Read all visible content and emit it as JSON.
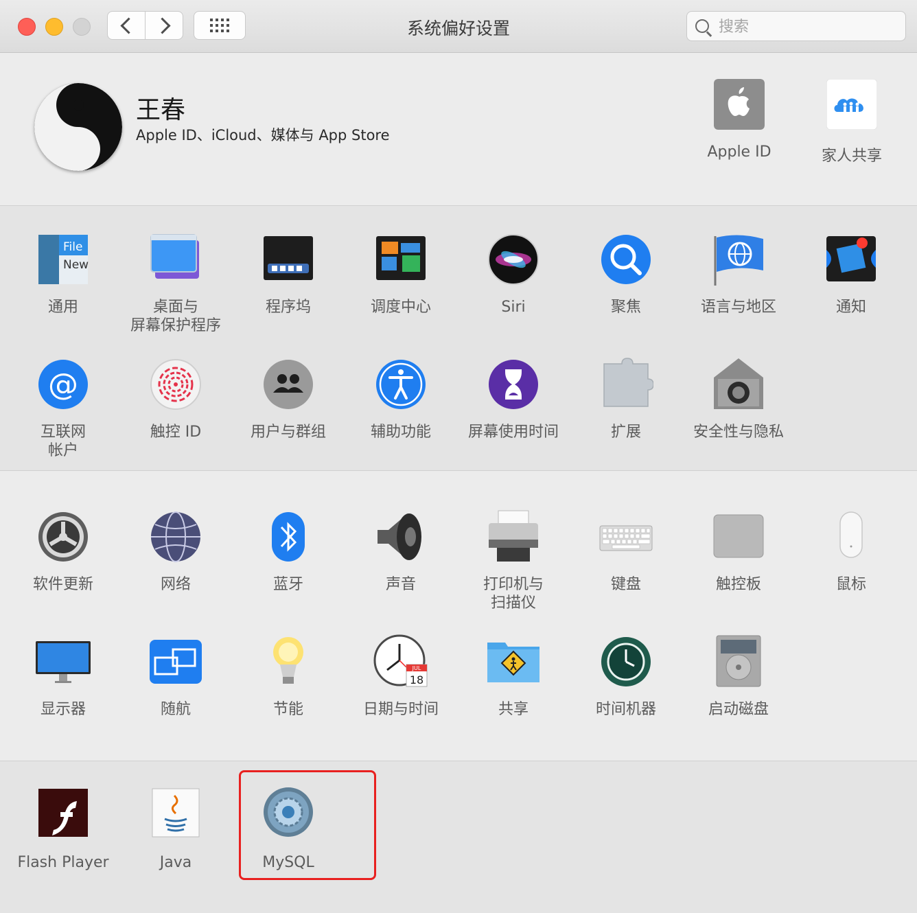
{
  "window": {
    "title": "系统偏好设置"
  },
  "search": {
    "placeholder": "搜索"
  },
  "account": {
    "name": "王春",
    "subtitle": "Apple ID、iCloud、媒体与 App Store",
    "items": [
      {
        "label": "Apple ID",
        "icon": "apple-icon"
      },
      {
        "label": "家人共享",
        "icon": "family-sharing-icon"
      }
    ]
  },
  "section1": {
    "row1": [
      {
        "label1": "通用",
        "label2": "",
        "icon": "general-icon"
      },
      {
        "label1": "桌面与",
        "label2": "屏幕保护程序",
        "icon": "desktop-icon"
      },
      {
        "label1": "程序坞",
        "label2": "",
        "icon": "dock-icon"
      },
      {
        "label1": "调度中心",
        "label2": "",
        "icon": "mission-control-icon"
      },
      {
        "label1": "Siri",
        "label2": "",
        "icon": "siri-icon"
      },
      {
        "label1": "聚焦",
        "label2": "",
        "icon": "spotlight-icon"
      },
      {
        "label1": "语言与地区",
        "label2": "",
        "icon": "language-icon"
      },
      {
        "label1": "通知",
        "label2": "",
        "icon": "notifications-icon"
      }
    ],
    "row2": [
      {
        "label1": "互联网",
        "label2": "帐户",
        "icon": "internet-accounts-icon"
      },
      {
        "label1": "触控 ID",
        "label2": "",
        "icon": "touch-id-icon"
      },
      {
        "label1": "用户与群组",
        "label2": "",
        "icon": "users-groups-icon"
      },
      {
        "label1": "辅助功能",
        "label2": "",
        "icon": "accessibility-icon"
      },
      {
        "label1": "屏幕使用时间",
        "label2": "",
        "icon": "screen-time-icon"
      },
      {
        "label1": "扩展",
        "label2": "",
        "icon": "extensions-icon"
      },
      {
        "label1": "安全性与隐私",
        "label2": "",
        "icon": "security-icon"
      }
    ]
  },
  "section2": {
    "row1": [
      {
        "label1": "软件更新",
        "label2": "",
        "icon": "software-update-icon"
      },
      {
        "label1": "网络",
        "label2": "",
        "icon": "network-icon"
      },
      {
        "label1": "蓝牙",
        "label2": "",
        "icon": "bluetooth-icon"
      },
      {
        "label1": "声音",
        "label2": "",
        "icon": "sound-icon"
      },
      {
        "label1": "打印机与",
        "label2": "扫描仪",
        "icon": "printer-icon"
      },
      {
        "label1": "键盘",
        "label2": "",
        "icon": "keyboard-icon"
      },
      {
        "label1": "触控板",
        "label2": "",
        "icon": "trackpad-icon"
      },
      {
        "label1": "鼠标",
        "label2": "",
        "icon": "mouse-icon"
      }
    ],
    "row2": [
      {
        "label1": "显示器",
        "label2": "",
        "icon": "display-icon"
      },
      {
        "label1": "随航",
        "label2": "",
        "icon": "sidecar-icon"
      },
      {
        "label1": "节能",
        "label2": "",
        "icon": "energy-saver-icon"
      },
      {
        "label1": "日期与时间",
        "label2": "",
        "icon": "date-time-icon"
      },
      {
        "label1": "共享",
        "label2": "",
        "icon": "sharing-icon"
      },
      {
        "label1": "时间机器",
        "label2": "",
        "icon": "time-machine-icon"
      },
      {
        "label1": "启动磁盘",
        "label2": "",
        "icon": "startup-disk-icon"
      }
    ]
  },
  "section3": {
    "row1": [
      {
        "label1": "Flash Player",
        "label2": "",
        "icon": "flash-player-icon"
      },
      {
        "label1": "Java",
        "label2": "",
        "icon": "java-icon"
      },
      {
        "label1": "MySQL",
        "label2": "",
        "icon": "mysql-icon"
      }
    ]
  },
  "calendar": {
    "month": "JUL",
    "day": "18"
  },
  "colors": {
    "highlight": "#e8201f",
    "accent": "#1f7ef0"
  }
}
